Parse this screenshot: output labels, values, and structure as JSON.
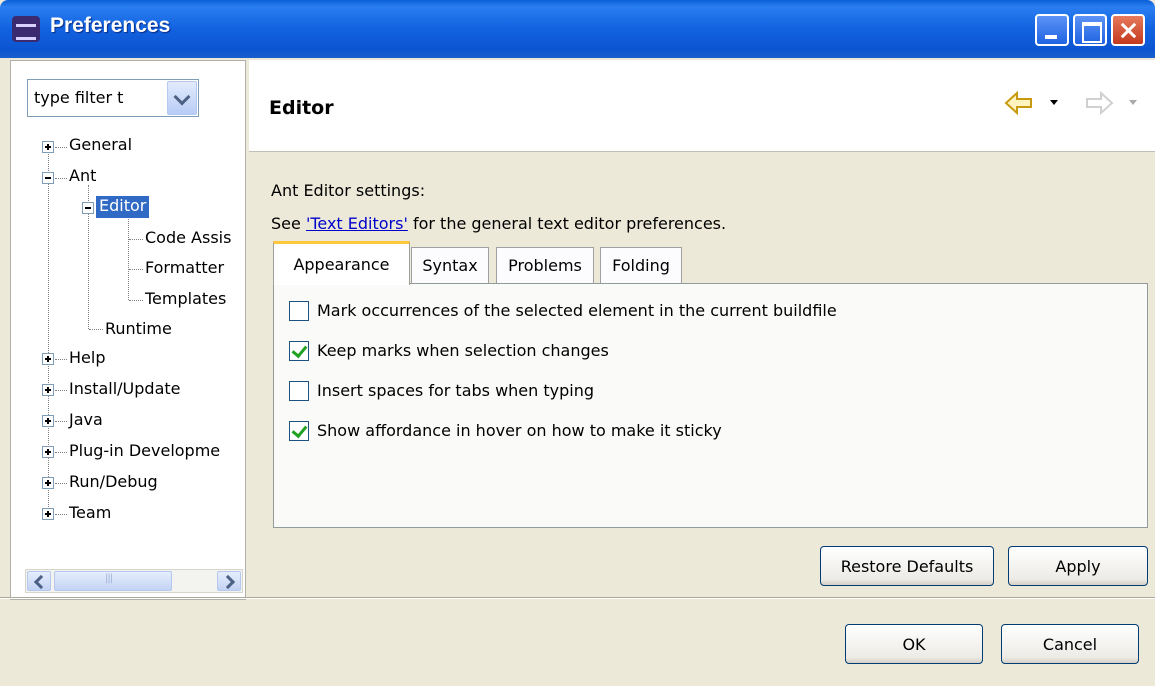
{
  "window": {
    "title": "Preferences"
  },
  "filter": {
    "text": "type filter t"
  },
  "tree": {
    "general": "General",
    "ant": "Ant",
    "editor": "Editor",
    "code_assist": "Code Assis",
    "formatter": "Formatter",
    "templates": "Templates",
    "runtime": "Runtime",
    "help": "Help",
    "install_update": "Install/Update",
    "java": "Java",
    "plugin_dev": "Plug-in Developme",
    "run_debug": "Run/Debug",
    "team": "Team"
  },
  "page": {
    "title": "Editor",
    "settings_label": "Ant Editor settings:",
    "see_prefix": "See ",
    "link": "'Text Editors'",
    "see_suffix": " for the general text editor preferences."
  },
  "tabs": {
    "appearance": "Appearance",
    "syntax": "Syntax",
    "problems": "Problems",
    "folding": "Folding"
  },
  "options": [
    {
      "label": "Mark occurrences of the selected element in the current buildfile",
      "checked": false
    },
    {
      "label": "Keep marks when selection changes",
      "checked": true
    },
    {
      "label": "Insert spaces for tabs when typing",
      "checked": false
    },
    {
      "label": "Show affordance in hover on how to make it sticky",
      "checked": true
    }
  ],
  "buttons": {
    "restore_defaults": "Restore Defaults",
    "apply": "Apply",
    "ok": "OK",
    "cancel": "Cancel"
  },
  "colors": {
    "selection": "#316ac5",
    "titlebar": "#0c55d2",
    "tab_highlight": "#ffc83c"
  }
}
